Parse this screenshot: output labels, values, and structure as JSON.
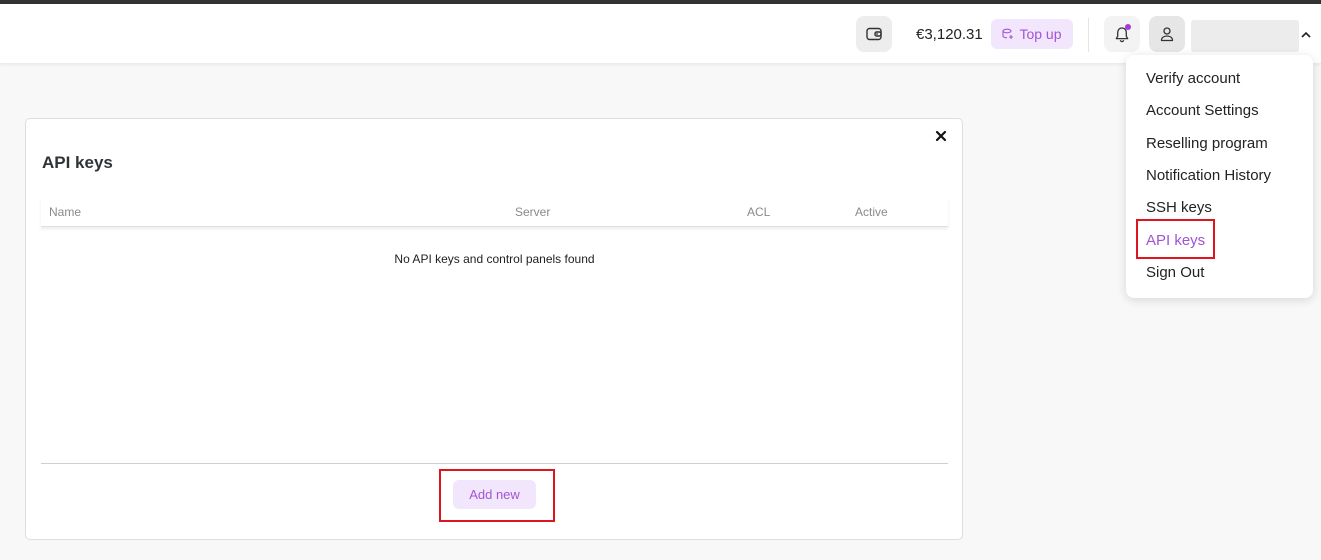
{
  "header": {
    "balance": "€3,120.31",
    "topup_label": "Top up",
    "icons": {
      "wallet": "wallet-icon",
      "topup": "coins-icon",
      "bell": "bell-icon",
      "user": "user-icon",
      "caret": "chevron-up-icon"
    },
    "notification_dot_color": "#a63ad8"
  },
  "dropdown": {
    "items": [
      "Verify account",
      "Account Settings",
      "Reselling program",
      "Notification History",
      "SSH keys",
      "API keys",
      "Sign Out"
    ],
    "active_item": "API keys"
  },
  "card": {
    "title": "API keys",
    "columns": [
      "Name",
      "Server",
      "ACL",
      "Active"
    ],
    "empty_message": "No API keys and control panels found",
    "add_label": "Add new"
  },
  "colors": {
    "accent": "#a255d6",
    "accent_bg": "#f1e6fb",
    "highlight": "#e0141e"
  }
}
